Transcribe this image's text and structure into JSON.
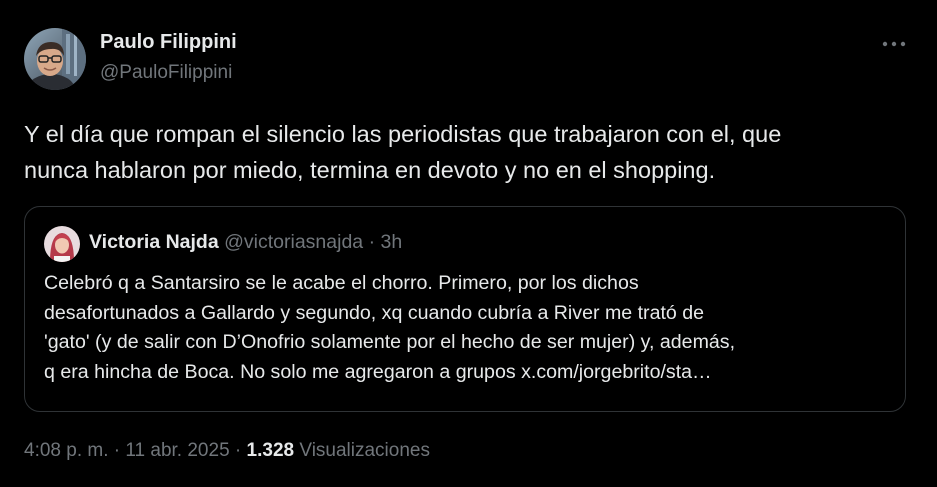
{
  "author": {
    "name": "Paulo Filippini",
    "handle": "@PauloFilippini",
    "avatar_icon": "person-photo-icon"
  },
  "more_icon": "more-horizontal-icon",
  "tweet": {
    "line1": "Y el día que rompan el silencio las periodistas que trabajaron con el, que",
    "line2": "nunca hablaron por miedo, termina en devoto y no en el shopping."
  },
  "quote": {
    "name": "Victoria Najda",
    "handle": "@victoriasnajda",
    "separator": "·",
    "time": "3h",
    "avatar_icon": "person-photo-icon",
    "lines": [
      "Celebró q a Santarsiro se le acabe el chorro. Primero, por los dichos",
      "desafortunados a Gallardo y segundo, xq cuando cubría a River me trató de",
      "'gato' (y de salir con D’Onofrio solamente por el hecho de ser mujer) y, además,",
      "q era hincha de Boca. No solo me agregaron a grupos x.com/jorgebrito/sta…"
    ]
  },
  "meta": {
    "time": "4:08 p. m.",
    "sep1": "·",
    "date": "11 abr. 2025",
    "sep2": "·",
    "views_count": "1.328",
    "views_label": "Visualizaciones"
  },
  "colors": {
    "background": "#000000",
    "primary_text": "#e7e9ea",
    "secondary_text": "#71767b",
    "border": "#2f3336"
  }
}
